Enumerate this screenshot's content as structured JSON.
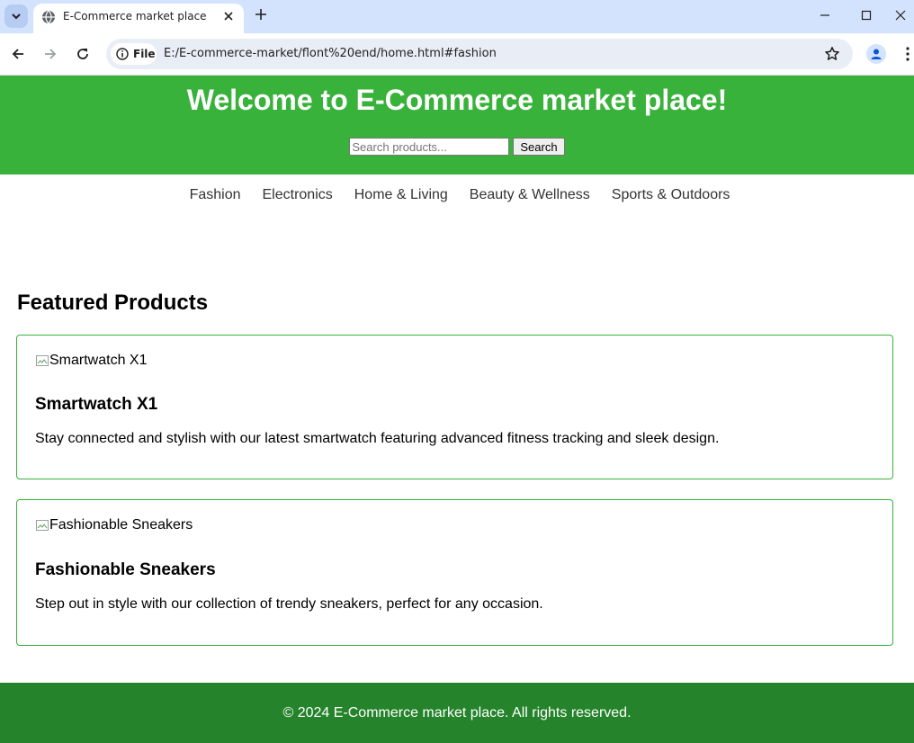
{
  "browser": {
    "tab_title": "E-Commerce market place",
    "security_chip": "File",
    "url": "E:/E-commerce-market/flont%20end/home.html#fashion"
  },
  "header": {
    "title": "Welcome to E-Commerce market place!",
    "search_placeholder": "Search products...",
    "search_value": "",
    "search_button": "Search",
    "background_color": "#38b23a"
  },
  "nav": {
    "items": [
      {
        "label": "Fashion"
      },
      {
        "label": "Electronics"
      },
      {
        "label": "Home & Living"
      },
      {
        "label": "Beauty & Wellness"
      },
      {
        "label": "Sports & Outdoors"
      }
    ]
  },
  "featured": {
    "title": "Featured Products",
    "products": [
      {
        "image_alt": "Smartwatch X1",
        "name": "Smartwatch X1",
        "description": "Stay connected and stylish with our latest smartwatch featuring advanced fitness tracking and sleek design."
      },
      {
        "image_alt": "Fashionable Sneakers",
        "name": "Fashionable Sneakers",
        "description": "Step out in style with our collection of trendy sneakers, perfect for any occasion."
      }
    ]
  },
  "footer": {
    "text": "© 2024 E-Commerce market place. All rights reserved.",
    "background_color": "#24832b"
  }
}
